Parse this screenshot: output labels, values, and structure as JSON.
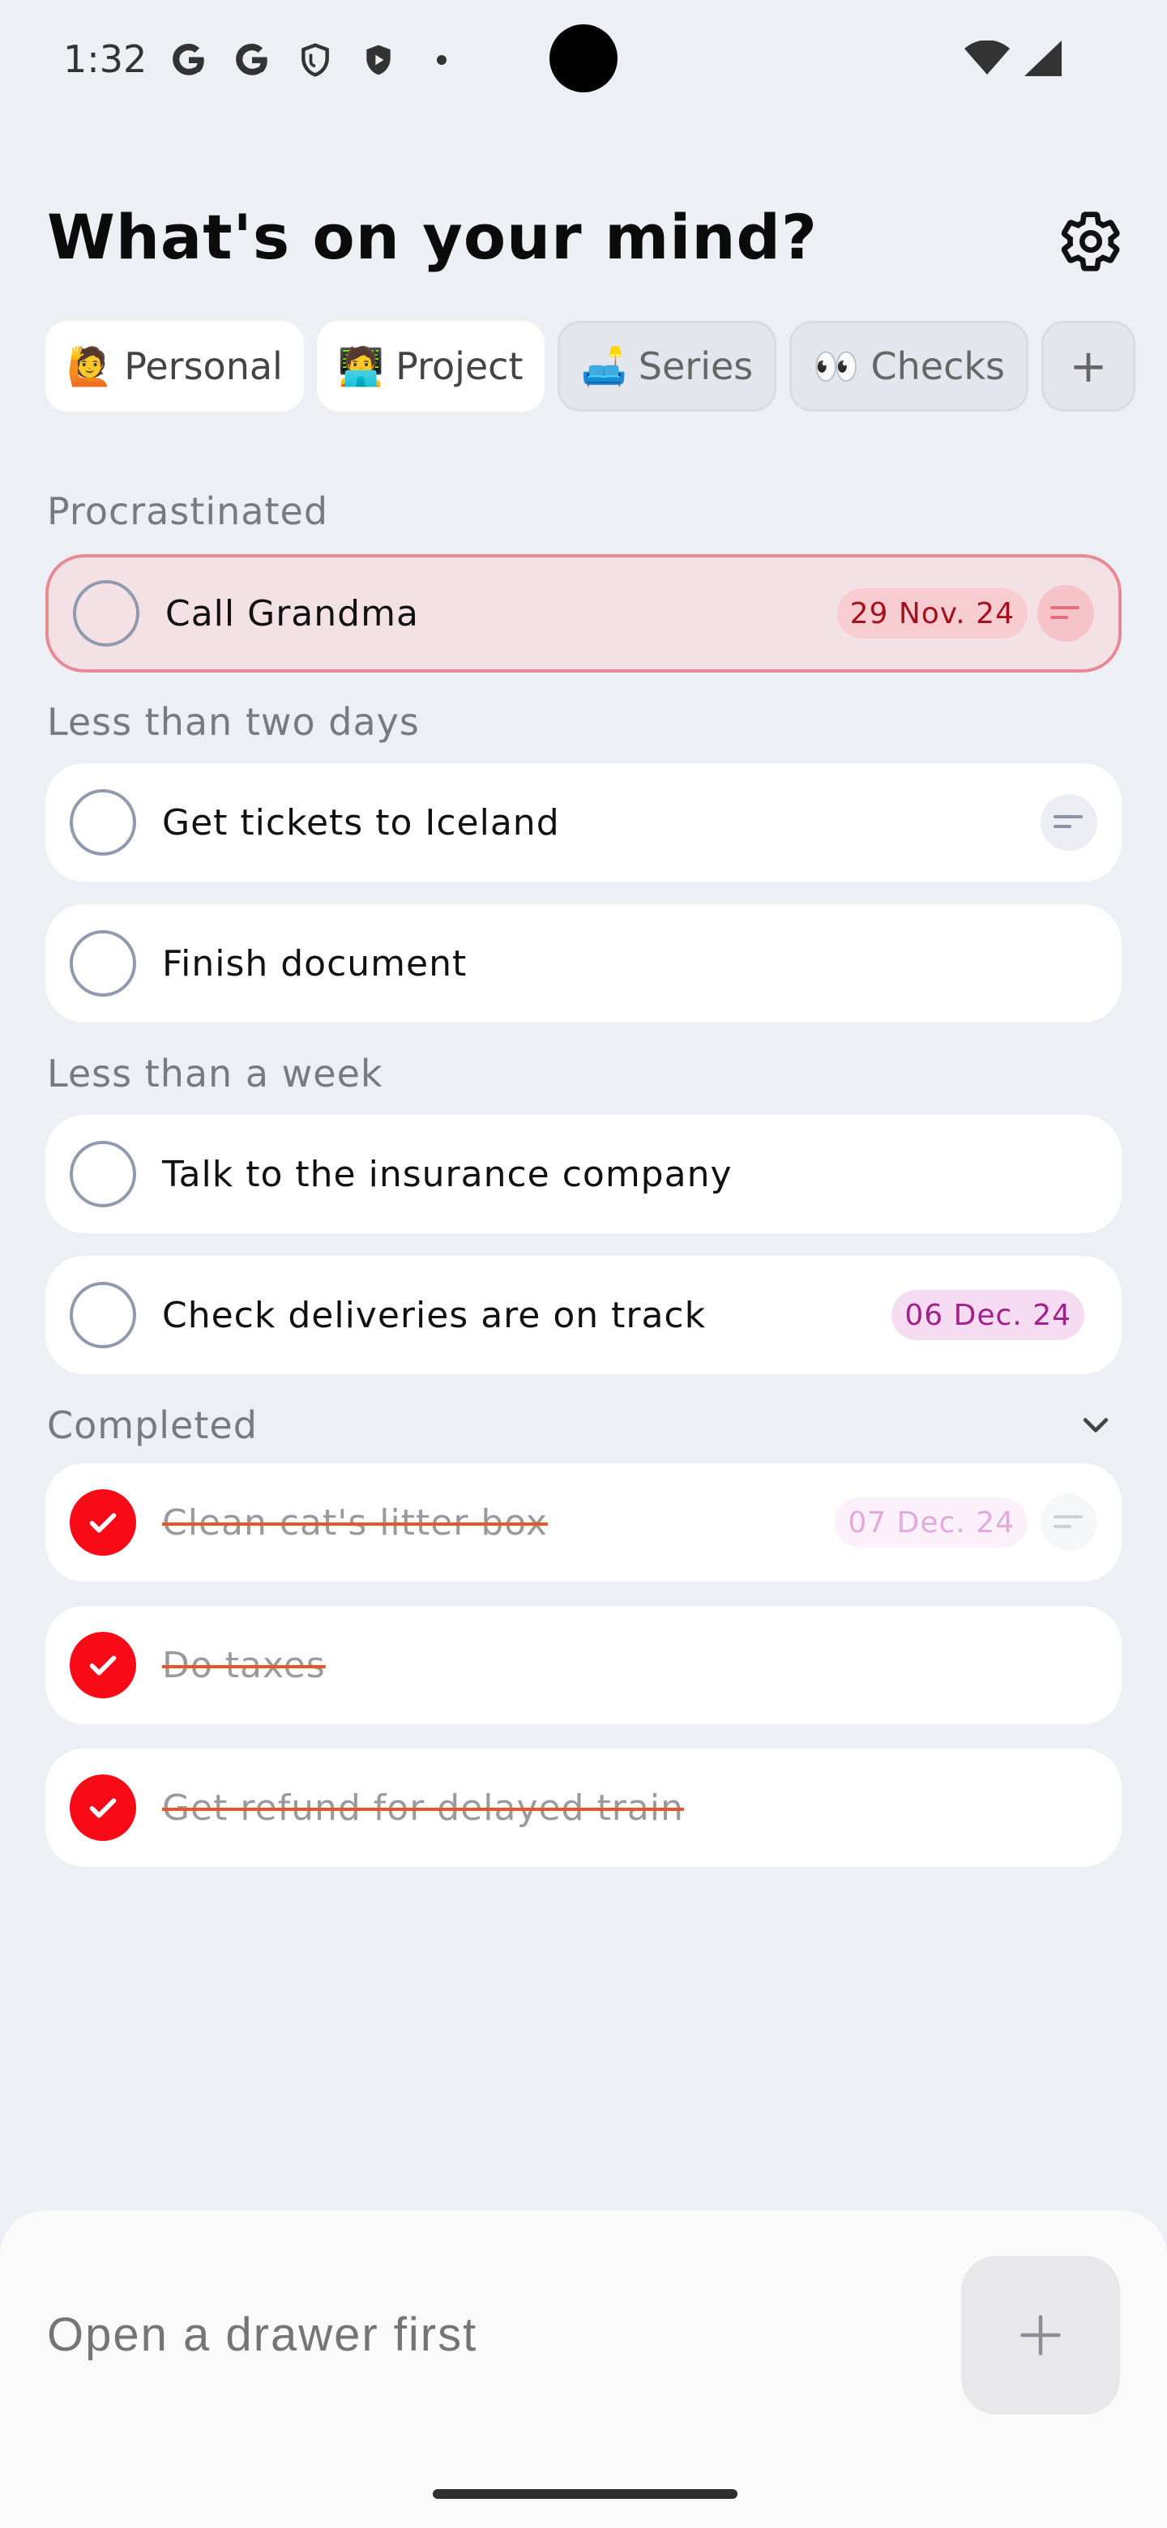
{
  "status_bar": {
    "time": "1:32",
    "icons": [
      "google-g-icon",
      "google-g-icon",
      "shield-outline-icon",
      "shield-play-icon",
      "dot-icon"
    ],
    "right_icons": [
      "wifi-icon",
      "signal-icon"
    ]
  },
  "header": {
    "title": "What's on your mind?",
    "settings_icon": "gear-icon"
  },
  "tabs": [
    {
      "emoji": "🙋",
      "label": "Personal",
      "active": true
    },
    {
      "emoji": "🧑‍💻",
      "label": "Project",
      "active": true
    },
    {
      "emoji": "🛋️",
      "label": "Series",
      "active": false
    },
    {
      "emoji": "👀",
      "label": "Checks",
      "active": false
    }
  ],
  "tab_add_label": "+",
  "sections": {
    "procrastinated": "Procrastinated",
    "two_days": "Less than two days",
    "week": "Less than a week",
    "completed": "Completed"
  },
  "tasks": {
    "call_grandma": {
      "text": "Call Grandma",
      "date": "29 Nov. 24",
      "has_note": true
    },
    "iceland": {
      "text": "Get tickets to Iceland",
      "has_note": true
    },
    "finish_doc": {
      "text": "Finish document"
    },
    "insurance": {
      "text": "Talk to the insurance company"
    },
    "deliveries": {
      "text": "Check deliveries are on track",
      "date": "06 Dec. 24"
    },
    "litter": {
      "text": "Clean cat's litter box",
      "date": "07 Dec. 24",
      "done": true,
      "has_note": true
    },
    "taxes": {
      "text": "Do taxes",
      "done": true
    },
    "refund": {
      "text": "Get refund for delayed train",
      "done": true
    }
  },
  "composer": {
    "placeholder": "Open a drawer first",
    "add_icon": "plus-icon"
  },
  "colors": {
    "background": "#eceff4",
    "checked": "#f80a16",
    "overdue_bg": "#f3e1e5",
    "overdue_border": "#e78a96",
    "strike": "#e2572b"
  }
}
